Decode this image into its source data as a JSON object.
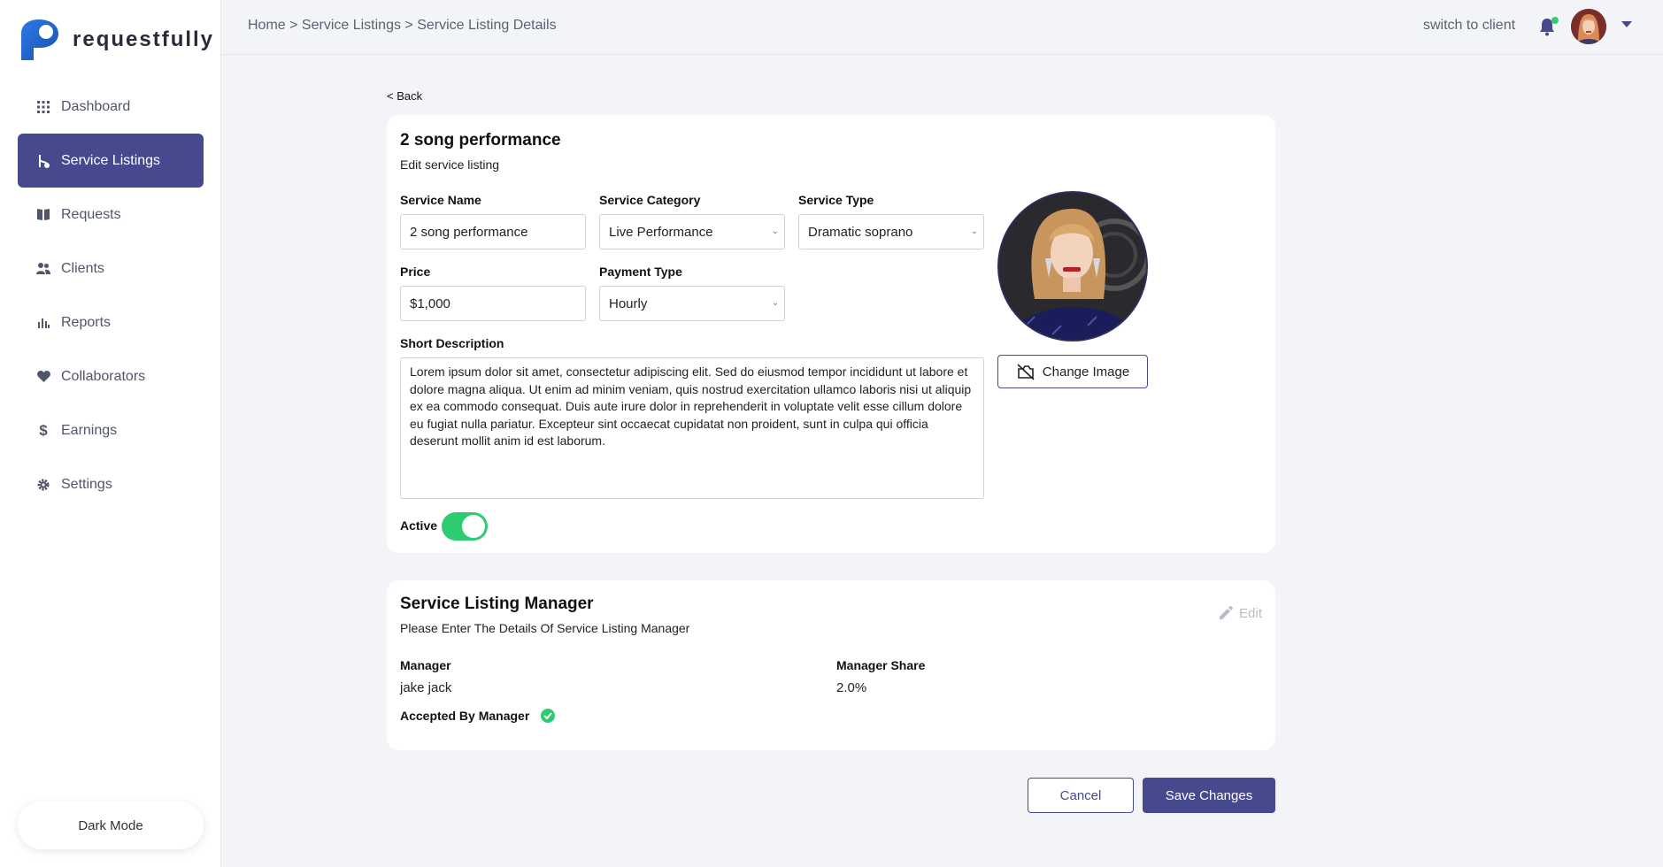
{
  "app": {
    "name": "requestfully"
  },
  "sidebar": {
    "items": [
      {
        "label": "Dashboard",
        "icon": "grid-icon"
      },
      {
        "label": "Service Listings",
        "icon": "branch-icon",
        "active": true
      },
      {
        "label": "Requests",
        "icon": "book-icon"
      },
      {
        "label": "Clients",
        "icon": "users-icon"
      },
      {
        "label": "Reports",
        "icon": "bar-chart-icon"
      },
      {
        "label": "Collaborators",
        "icon": "heart-icon"
      },
      {
        "label": "Earnings",
        "icon": "dollar-icon"
      },
      {
        "label": "Settings",
        "icon": "gear-icon"
      }
    ],
    "dark_mode_label": "Dark Mode"
  },
  "topbar": {
    "breadcrumb": "Home > Service Listings > Service Listing Details",
    "switch_label": "switch to client"
  },
  "main": {
    "back_label": "< Back",
    "listing": {
      "title": "2 song performance",
      "subtitle": "Edit service listing",
      "service_name_label": "Service Name",
      "service_name_value": "2 song performance",
      "service_category_label": "Service Category",
      "service_category_value": "Live Performance",
      "service_type_label": "Service Type",
      "service_type_value": "Dramatic soprano",
      "price_label": "Price",
      "price_value": "$1,000",
      "payment_type_label": "Payment Type",
      "payment_type_value": "Hourly",
      "description_label": "Short Description",
      "description_value": "Lorem ipsum dolor sit amet, consectetur adipiscing elit. Sed do eiusmod tempor incididunt ut labore et dolore magna aliqua. Ut enim ad minim veniam, quis nostrud exercitation ullamco laboris nisi ut aliquip ex ea commodo consequat. Duis aute irure dolor in reprehenderit in voluptate velit esse cillum dolore eu fugiat nulla pariatur. Excepteur sint occaecat cupidatat non proident, sunt in culpa qui officia deserunt mollit anim id est laborum.",
      "active_label": "Active",
      "active": true,
      "change_image_label": "Change Image"
    },
    "manager": {
      "title": "Service Listing Manager",
      "subtitle": "Please Enter The Details Of Service Listing Manager",
      "edit_label": "Edit",
      "manager_label": "Manager",
      "manager_value": "jake jack",
      "share_label": "Manager Share",
      "share_value": "2.0%",
      "accepted_label": "Accepted By Manager"
    },
    "actions": {
      "cancel_label": "Cancel",
      "save_label": "Save Changes"
    }
  },
  "colors": {
    "accent": "#47498f",
    "success": "#2ecc71",
    "background": "#f3f4f7"
  }
}
